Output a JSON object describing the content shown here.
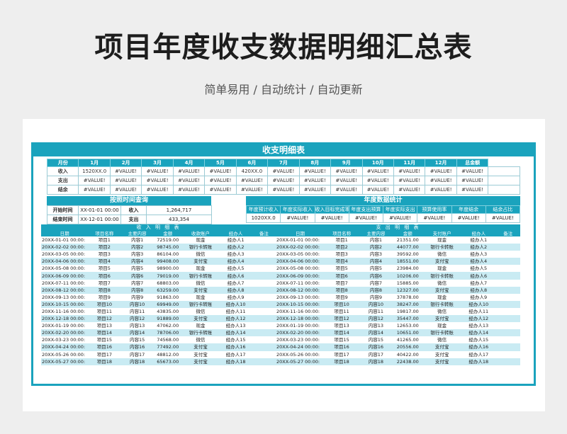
{
  "title": "项目年度收支数据明细汇总表",
  "subtitle": "简单易用 / 自动统计 / 自动更新",
  "sheet_title": "收支明细表",
  "summary": {
    "headers": [
      "月份",
      "1月",
      "2月",
      "3月",
      "4月",
      "5月",
      "6月",
      "7月",
      "8月",
      "9月",
      "10月",
      "11月",
      "12月",
      "总金额"
    ],
    "rows": [
      {
        "label": "收入",
        "cells": [
          "1520XX.0",
          "#VALUE!",
          "#VALUE!",
          "#VALUE!",
          "#VALUE!",
          "420XX.0",
          "#VALUE!",
          "#VALUE!",
          "#VALUE!",
          "#VALUE!",
          "#VALUE!",
          "#VALUE!",
          "#VALUE!"
        ]
      },
      {
        "label": "支出",
        "cells": [
          "#VALUE!",
          "#VALUE!",
          "#VALUE!",
          "#VALUE!",
          "#VALUE!",
          "#VALUE!",
          "#VALUE!",
          "#VALUE!",
          "#VALUE!",
          "#VALUE!",
          "#VALUE!",
          "#VALUE!",
          "#VALUE!"
        ]
      },
      {
        "label": "结余",
        "cells": [
          "#VALUE!",
          "#VALUE!",
          "#VALUE!",
          "#VALUE!",
          "#VALUE!",
          "#VALUE!",
          "#VALUE!",
          "#VALUE!",
          "#VALUE!",
          "#VALUE!",
          "#VALUE!",
          "#VALUE!",
          "#VALUE!"
        ]
      }
    ]
  },
  "query": {
    "title": "按照时间查询",
    "start_label": "开始时间",
    "start_value": "XX-01-01 00:00",
    "income_label": "收入",
    "income_value": "1,264,717",
    "end_label": "结束时间",
    "end_value": "XX-12-01 00:00",
    "expense_label": "支出",
    "expense_value": "433,354"
  },
  "stats": {
    "title": "年度数据统计",
    "headers": [
      "年度预计收入",
      "年度实际收入",
      "收入目标完成率",
      "年度支出预算",
      "年度实际支出",
      "预算使用率",
      "年度结余",
      "结余占比"
    ],
    "values": [
      "1020XX.0",
      "#VALUE!",
      "#VALUE!",
      "#VALUE!",
      "#VALUE!",
      "#VALUE!",
      "#VALUE!",
      "#VALUE!"
    ]
  },
  "income_detail": {
    "title": "收 入 明 细 表",
    "headers": [
      "日期",
      "项目名称",
      "主要内容",
      "金额",
      "收款账户",
      "经办人",
      "备注"
    ],
    "rows": [
      [
        "20XX-01-01 00:00:",
        "项目1",
        "内容1",
        "72519.00",
        "现金",
        "经办人1",
        ""
      ],
      [
        "20XX-02-02 00:00:",
        "项目2",
        "内容2",
        "98745.00",
        "银行卡转账",
        "经办人2",
        ""
      ],
      [
        "20XX-03-05 00:00:",
        "项目3",
        "内容3",
        "86104.00",
        "微信",
        "经办人3",
        ""
      ],
      [
        "20XX-04-06 00:00:",
        "项目4",
        "内容4",
        "99408.00",
        "支付宝",
        "经办人4",
        ""
      ],
      [
        "20XX-05-08 00:00:",
        "项目5",
        "内容5",
        "98900.00",
        "现金",
        "经办人5",
        ""
      ],
      [
        "20XX-06-09 00:00:",
        "项目6",
        "内容6",
        "79019.00",
        "银行卡转账",
        "经办人6",
        ""
      ],
      [
        "20XX-07-11 00:00:",
        "项目7",
        "内容7",
        "68803.00",
        "微信",
        "经办人7",
        ""
      ],
      [
        "20XX-08-12 00:00:",
        "项目8",
        "内容8",
        "63259.00",
        "支付宝",
        "经办人8",
        ""
      ],
      [
        "20XX-09-13 00:00:",
        "项目9",
        "内容9",
        "91863.00",
        "现金",
        "经办人9",
        ""
      ],
      [
        "20XX-10-15 00:00:",
        "项目10",
        "内容10",
        "69949.00",
        "银行卡转账",
        "经办人10",
        ""
      ],
      [
        "20XX-11-16 00:00:",
        "项目11",
        "内容11",
        "43835.00",
        "微信",
        "经办人11",
        ""
      ],
      [
        "20XX-12-18 00:00:",
        "项目12",
        "内容12",
        "91889.00",
        "支付宝",
        "经办人12",
        ""
      ],
      [
        "20XX-01-19 00:00:",
        "项目13",
        "内容13",
        "47062.00",
        "现金",
        "经办人13",
        ""
      ],
      [
        "20XX-02-20 00:00:",
        "项目14",
        "内容14",
        "78706.00",
        "银行卡转账",
        "经办人14",
        ""
      ],
      [
        "20XX-03-23 00:00:",
        "项目15",
        "内容15",
        "74568.00",
        "微信",
        "经办人15",
        ""
      ],
      [
        "20XX-04-24 00:00:",
        "项目16",
        "内容16",
        "77492.00",
        "支付宝",
        "经办人16",
        ""
      ],
      [
        "20XX-05-26 00:00:",
        "项目17",
        "内容17",
        "48812.00",
        "支付宝",
        "经办人17",
        ""
      ],
      [
        "20XX-05-27 00:00:",
        "项目18",
        "内容18",
        "65673.00",
        "支付宝",
        "经办人18",
        ""
      ]
    ]
  },
  "expense_detail": {
    "title": "支 出 明 细 表",
    "headers": [
      "日期",
      "项目名称",
      "主要内容",
      "金额",
      "支付账户",
      "经办人",
      "备注"
    ],
    "rows": [
      [
        "20XX-01-01 00:00:",
        "项目1",
        "内容1",
        "21351.00",
        "现金",
        "经办人1",
        ""
      ],
      [
        "20XX-02-02 00:00:",
        "项目2",
        "内容2",
        "44077.00",
        "银行卡转账",
        "经办人2",
        ""
      ],
      [
        "20XX-03-05 00:00:",
        "项目3",
        "内容3",
        "39592.00",
        "微信",
        "经办人3",
        ""
      ],
      [
        "20XX-04-06 00:00:",
        "项目4",
        "内容4",
        "18551.00",
        "支付宝",
        "经办人4",
        ""
      ],
      [
        "20XX-05-08 00:00:",
        "项目5",
        "内容5",
        "23984.00",
        "现金",
        "经办人5",
        ""
      ],
      [
        "20XX-06-09 00:00:",
        "项目6",
        "内容6",
        "10206.00",
        "银行卡转账",
        "经办人6",
        ""
      ],
      [
        "20XX-07-11 00:00:",
        "项目7",
        "内容7",
        "15885.00",
        "微信",
        "经办人7",
        ""
      ],
      [
        "20XX-08-12 00:00:",
        "项目8",
        "内容8",
        "12327.00",
        "支付宝",
        "经办人8",
        ""
      ],
      [
        "20XX-09-13 00:00:",
        "项目9",
        "内容9",
        "37878.00",
        "现金",
        "经办人9",
        ""
      ],
      [
        "20XX-10-15 00:00:",
        "项目10",
        "内容10",
        "38247.00",
        "银行卡转账",
        "经办人10",
        ""
      ],
      [
        "20XX-11-16 00:00:",
        "项目11",
        "内容11",
        "19817.00",
        "微信",
        "经办人11",
        ""
      ],
      [
        "20XX-12-18 00:00:",
        "项目12",
        "内容12",
        "35447.00",
        "支付宝",
        "经办人12",
        ""
      ],
      [
        "20XX-01-19 00:00:",
        "项目13",
        "内容13",
        "12653.00",
        "现金",
        "经办人13",
        ""
      ],
      [
        "20XX-02-20 00:00:",
        "项目14",
        "内容14",
        "10651.00",
        "银行卡转账",
        "经办人14",
        ""
      ],
      [
        "20XX-03-23 00:00:",
        "项目15",
        "内容15",
        "41265.00",
        "微信",
        "经办人15",
        ""
      ],
      [
        "20XX-04-24 00:00:",
        "项目16",
        "内容16",
        "20556.00",
        "支付宝",
        "经办人16",
        ""
      ],
      [
        "20XX-05-26 00:00:",
        "项目17",
        "内容17",
        "40422.00",
        "支付宝",
        "经办人17",
        ""
      ],
      [
        "20XX-05-27 00:00:",
        "项目18",
        "内容18",
        "22438.00",
        "支付宝",
        "经办人18",
        ""
      ]
    ]
  },
  "colors": {
    "accent": "#1aa3bd",
    "row_alt": "#c9ebf3"
  }
}
